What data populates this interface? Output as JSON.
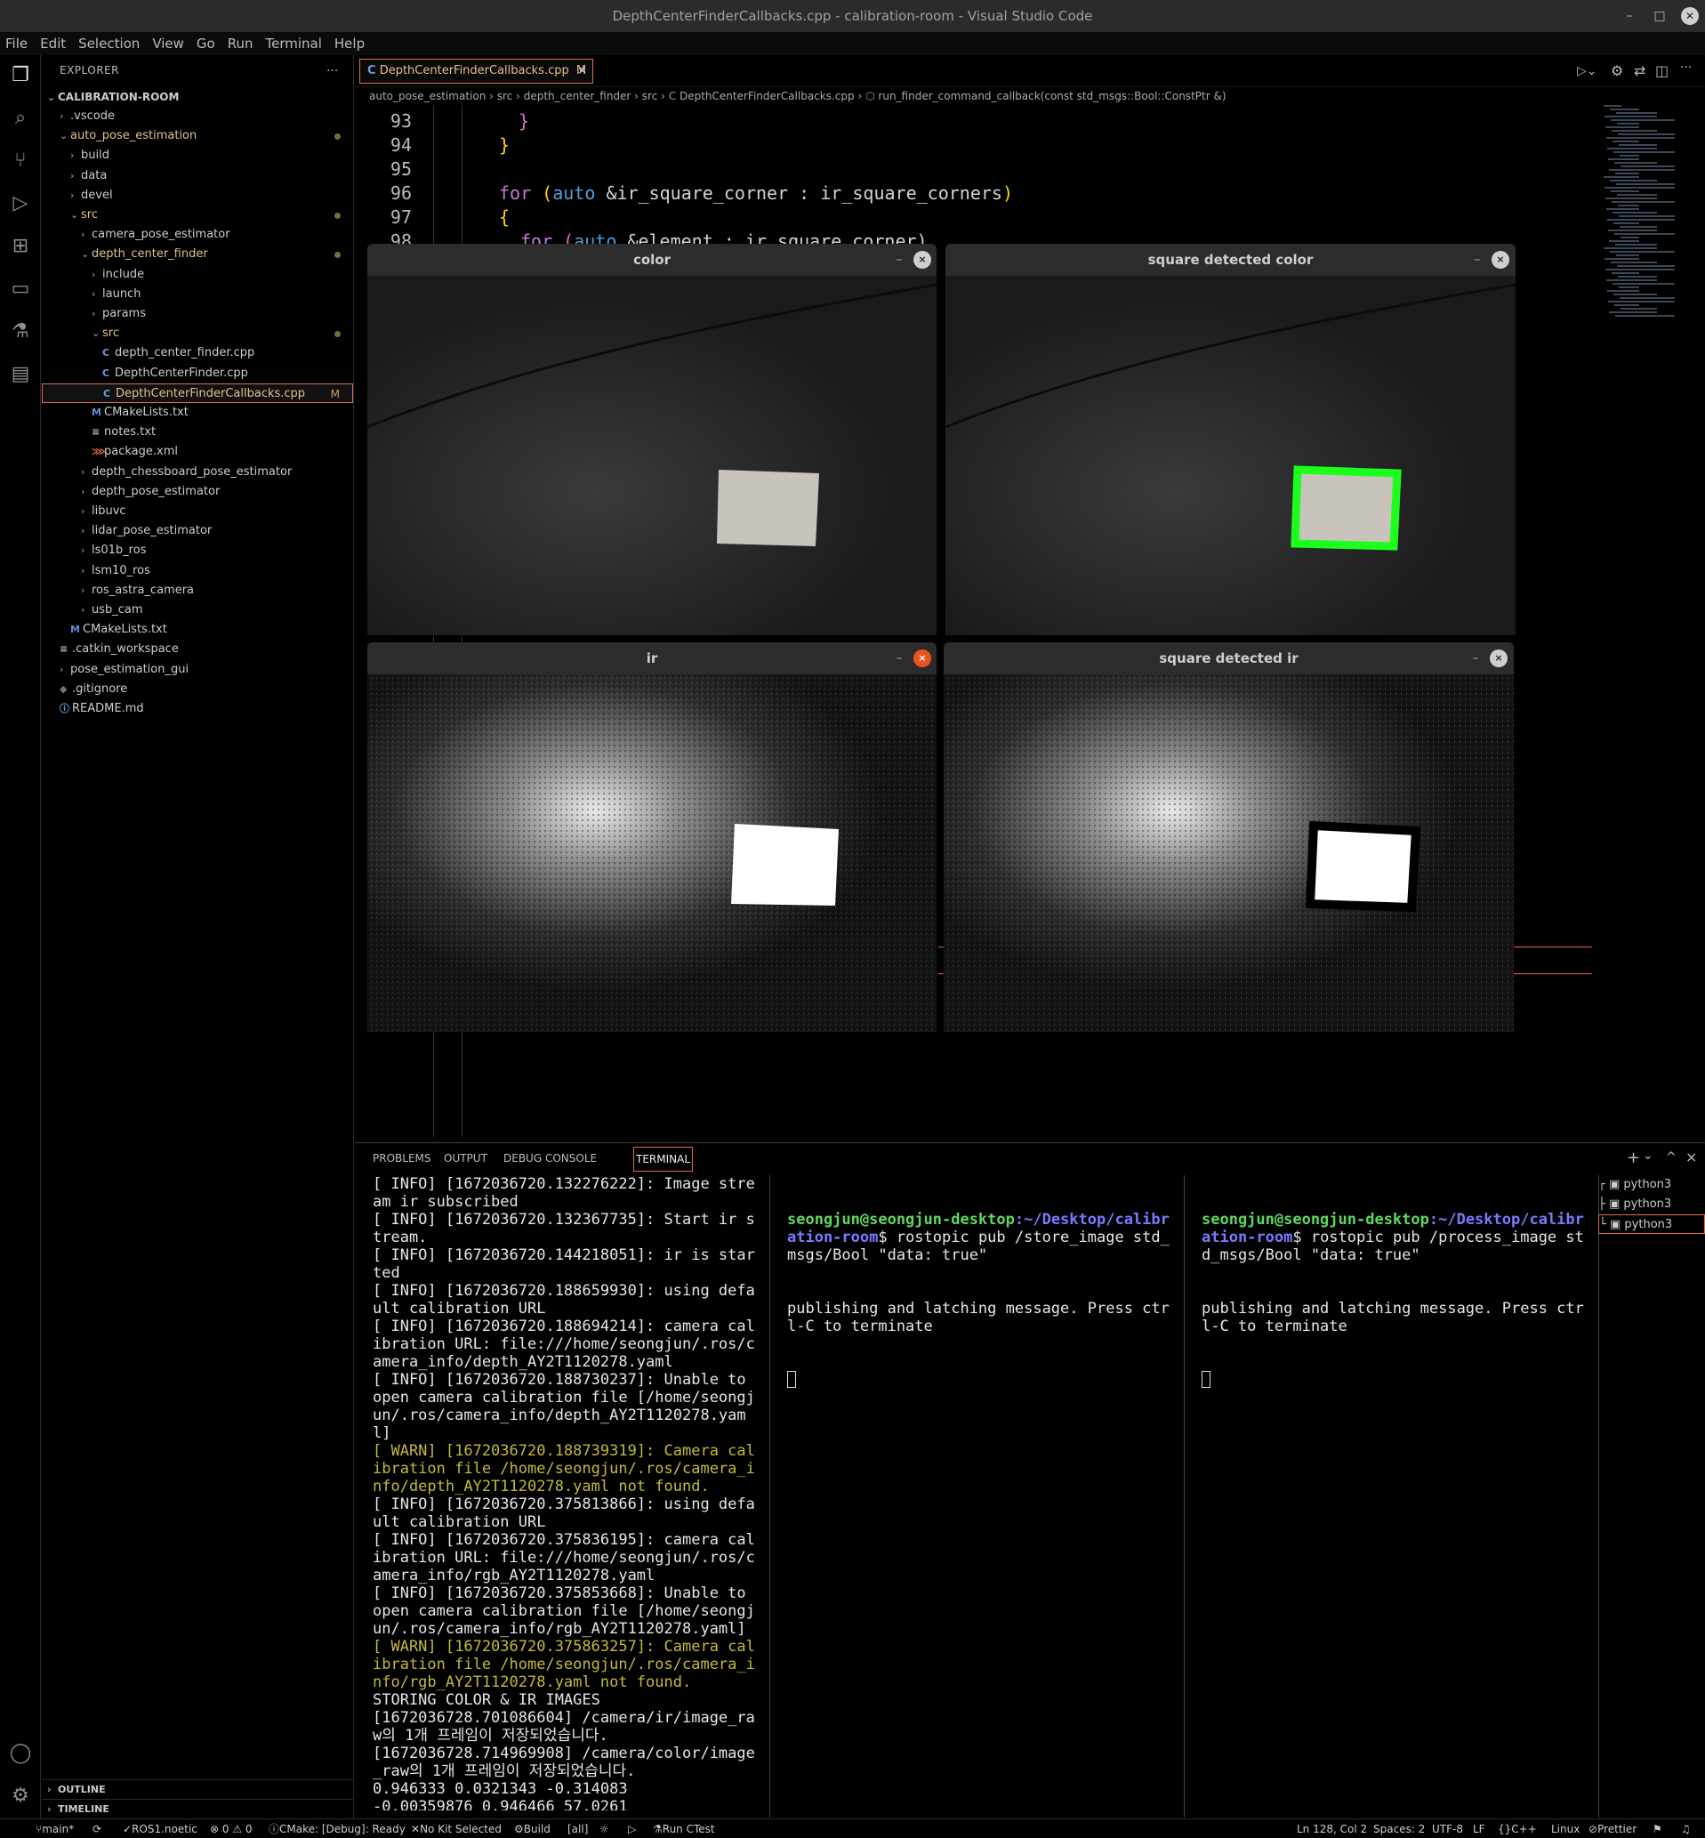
{
  "window": {
    "title": "DepthCenterFinderCallbacks.cpp - calibration-room - Visual Studio Code"
  },
  "menu": [
    "File",
    "Edit",
    "Selection",
    "View",
    "Go",
    "Run",
    "Terminal",
    "Help"
  ],
  "sidebar": {
    "header": "EXPLORER",
    "more": "...",
    "root": "CALIBRATION-ROOM",
    "items": [
      {
        "label": ".vscode",
        "chevron": "›"
      },
      {
        "label": "auto_pose_estimation",
        "chevron": "⌄"
      },
      {
        "label": "build",
        "chevron": "›"
      },
      {
        "label": "data",
        "chevron": "›"
      },
      {
        "label": "devel",
        "chevron": "›"
      },
      {
        "label": "src",
        "chevron": "⌄"
      },
      {
        "label": "camera_pose_estimator",
        "chevron": "›"
      },
      {
        "label": "depth_center_finder",
        "chevron": "⌄"
      },
      {
        "label": "include",
        "chevron": "›"
      },
      {
        "label": "launch",
        "chevron": "›"
      },
      {
        "label": "params",
        "chevron": "›"
      },
      {
        "label": "src",
        "chevron": "⌄"
      },
      {
        "label": "depth_center_finder.cpp",
        "icon": "C"
      },
      {
        "label": "DepthCenterFinder.cpp",
        "icon": "C"
      },
      {
        "label": "DepthCenterFinderCallbacks.cpp",
        "icon": "C",
        "badge": "M"
      },
      {
        "label": "CMakeLists.txt",
        "icon": "M"
      },
      {
        "label": "notes.txt",
        "icon": "≡"
      },
      {
        "label": "package.xml",
        "icon": "⋙"
      },
      {
        "label": "depth_chessboard_pose_estimator",
        "chevron": "›"
      },
      {
        "label": "depth_pose_estimator",
        "chevron": "›"
      },
      {
        "label": "libuvc",
        "chevron": "›"
      },
      {
        "label": "lidar_pose_estimator",
        "chevron": "›"
      },
      {
        "label": "ls01b_ros",
        "chevron": "›"
      },
      {
        "label": "lsm10_ros",
        "chevron": "›"
      },
      {
        "label": "ros_astra_camera",
        "chevron": "›"
      },
      {
        "label": "usb_cam",
        "chevron": "›"
      },
      {
        "label": "CMakeLists.txt",
        "icon": "M"
      },
      {
        "label": ".catkin_workspace",
        "icon": "≡"
      },
      {
        "label": "pose_estimation_gui",
        "chevron": "›"
      },
      {
        "label": ".gitignore",
        "icon": "◆"
      },
      {
        "label": "README.md",
        "icon": "ⓘ"
      }
    ],
    "outline": "OUTLINE",
    "timeline": "TIMELINE"
  },
  "tab": {
    "label": "DepthCenterFinderCallbacks.cpp",
    "badge": "M",
    "close": "×"
  },
  "breadcrumbs": {
    "b1": "auto_pose_estimation",
    "b2": "src",
    "b3": "depth_center_finder",
    "b4": "src",
    "b5": "DepthCenterFinderCallbacks.cpp",
    "b6": "run_finder_command_callback(const std_msgs::Bool::ConstPtr &)"
  },
  "code": {
    "line_numbers": [
      "93",
      "94",
      "95",
      "96",
      "97",
      "98"
    ],
    "l93": "}",
    "l94": "}",
    "l96_for": "for",
    "l96_auto": "auto",
    "l96_rest": "&ir_square_corner : ir_square_corners",
    "l97": "{",
    "l98_for": "for",
    "l98_auto": "auto",
    "l98_rest": "&element : ir_square_corner)"
  },
  "image_windows": [
    {
      "title": "color",
      "min": "–",
      "close": "×"
    },
    {
      "title": "square detected color",
      "min": "–",
      "close": "×"
    },
    {
      "title": "ir",
      "min": "–",
      "close": "×"
    },
    {
      "title": "square detected ir",
      "min": "–",
      "close": "×"
    }
  ],
  "panel": {
    "tabs": [
      "PROBLEMS",
      "OUTPUT",
      "DEBUG CONSOLE",
      "TERMINAL"
    ],
    "term1": [
      {
        "t": "[ INFO] [1672036720.132276222]: Image stream ir subscribed",
        "w": false
      },
      {
        "t": "[ INFO] [1672036720.132367735]: Start ir stream.",
        "w": false
      },
      {
        "t": "[ INFO] [1672036720.144218051]: ir is started",
        "w": false
      },
      {
        "t": "[ INFO] [1672036720.188659930]: using default calibration URL",
        "w": false
      },
      {
        "t": "[ INFO] [1672036720.188694214]: camera calibration URL: file:///home/seongjun/.ros/camera_info/depth_AY2T1120278.yaml",
        "w": false
      },
      {
        "t": "[ INFO] [1672036720.188730237]: Unable to open camera calibration file [/home/seongjun/.ros/camera_info/depth_AY2T1120278.yaml]",
        "w": false
      },
      {
        "t": "[ WARN] [1672036720.188739319]: Camera calibration file /home/seongjun/.ros/camera_info/depth_AY2T1120278.yaml not found.",
        "w": true
      },
      {
        "t": "[ INFO] [1672036720.375813866]: using default calibration URL",
        "w": false
      },
      {
        "t": "[ INFO] [1672036720.375836195]: camera calibration URL: file:///home/seongjun/.ros/camera_info/rgb_AY2T1120278.yaml",
        "w": false
      },
      {
        "t": "[ INFO] [1672036720.375853668]: Unable to open camera calibration file [/home/seongjun/.ros/camera_info/rgb_AY2T1120278.yaml]",
        "w": false
      },
      {
        "t": "[ WARN] [1672036720.375863257]: Camera calibration file /home/seongjun/.ros/camera_info/rgb_AY2T1120278.yaml not found.",
        "w": true
      },
      {
        "t": "STORING COLOR & IR IMAGES",
        "w": false
      },
      {
        "t": "[1672036728.701086604] /camera/ir/image_raw의 1개 프레임이 저장되었습니다.",
        "w": false
      },
      {
        "t": "[1672036728.714969908] /camera/color/image_raw의 1개 프레임이 저장되었습니다.",
        "w": false
      },
      {
        "t": "0.946333 0.0321343 -0.314083",
        "w": false
      },
      {
        "t": "-0.00359876 0.946466 57.0261",
        "w": false
      }
    ],
    "term2": {
      "user": "seongjun@seongjun-desktop",
      "path": ":~/Desktop/calibration-room",
      "cmd": "$ rostopic pub /store_image std_msgs/Bool \"data: true\"",
      "out": "publishing and latching message. Press ctrl-C to terminate"
    },
    "term3": {
      "user": "seongjun@seongjun-desktop",
      "path": ":~/Desktop/calibration-room",
      "cmd": "$ rostopic pub /process_image std_msgs/Bool \"data: true\"",
      "out": "publishing and latching message. Press ctrl-C to terminate"
    },
    "terminals": [
      "python3",
      "python3",
      "python3"
    ],
    "actions": {
      "add": "+",
      "chev": "⌄",
      "up": "^",
      "close": "×"
    }
  },
  "statusbar": {
    "branch": "main*",
    "sync": "⟳",
    "ros": "ROS1.noetic",
    "problems": "⊗ 0 ⚠ 0",
    "cmake": "CMake: [Debug]: Ready",
    "kit": "No Kit Selected",
    "build": "Build",
    "target": "[all]",
    "ctest": "Run CTest",
    "position": "Ln 128, Col 2",
    "spaces": "Spaces: 2",
    "encoding": "UTF-8",
    "eol": "LF",
    "lang": "C++",
    "os": "Linux",
    "prettier": "Prettier"
  }
}
